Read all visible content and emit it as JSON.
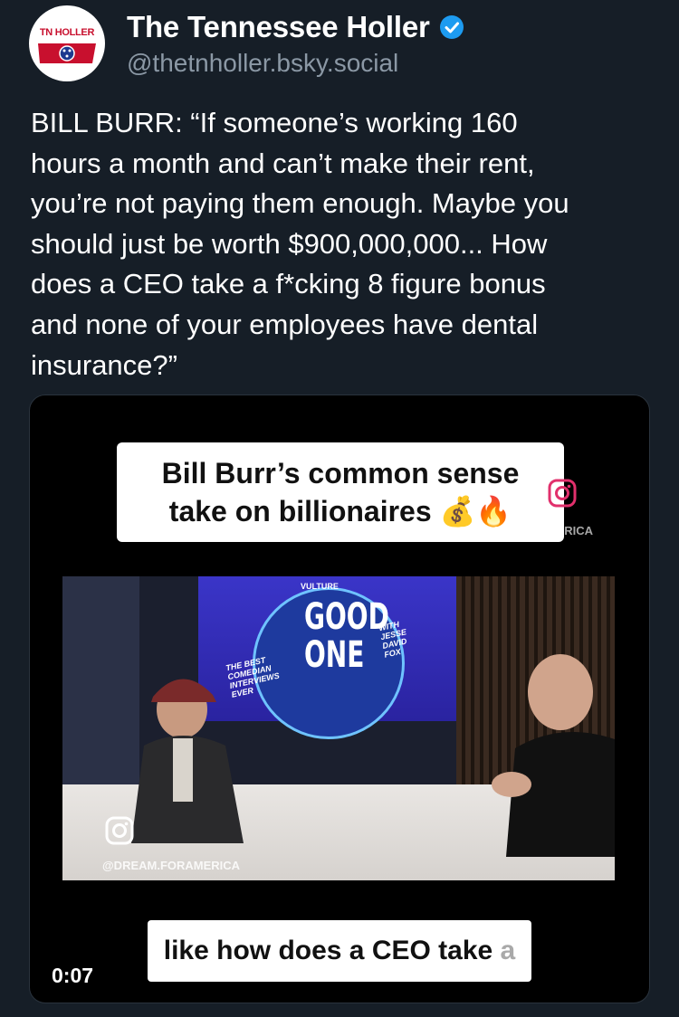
{
  "post": {
    "author_name": "The Tennessee Holler",
    "handle": "@thetnholler.bsky.social",
    "avatar_text": "TN HOLLER",
    "verified_icon": "verified-check-icon",
    "text": "BILL BURR: “If someone’s working 160\nhours a month and can’t make their rent,\nyou’re not paying them enough. Maybe you\nshould just be worth $900,000,000... How\ndoes a CEO take a f*cking 8 figure bonus\nand none of your employees have dental\ninsurance?”"
  },
  "video": {
    "caption_top_line1": "Bill Burr’s common sense",
    "caption_top_line2": "take on billionaires 💰🔥",
    "watermark_top": "@DREAM.FORAMERICA",
    "set_brand": "VULTURE",
    "set_title": "GOOD ONE",
    "set_left_text": "THE BEST COMEDIAN INTERVIEWS EVER",
    "set_right_text": "WITH JESSE DAVID FOX",
    "watermark_bottom": "@DREAM.FORAMERICA",
    "caption_bottom_main": "like how does a CEO take ",
    "caption_bottom_faded": "a",
    "timestamp": "0:07"
  },
  "colors": {
    "background": "#161e27",
    "handle_gray": "#8b98a5",
    "verified_blue": "#1d9bf0",
    "holler_red": "#c8102e"
  }
}
